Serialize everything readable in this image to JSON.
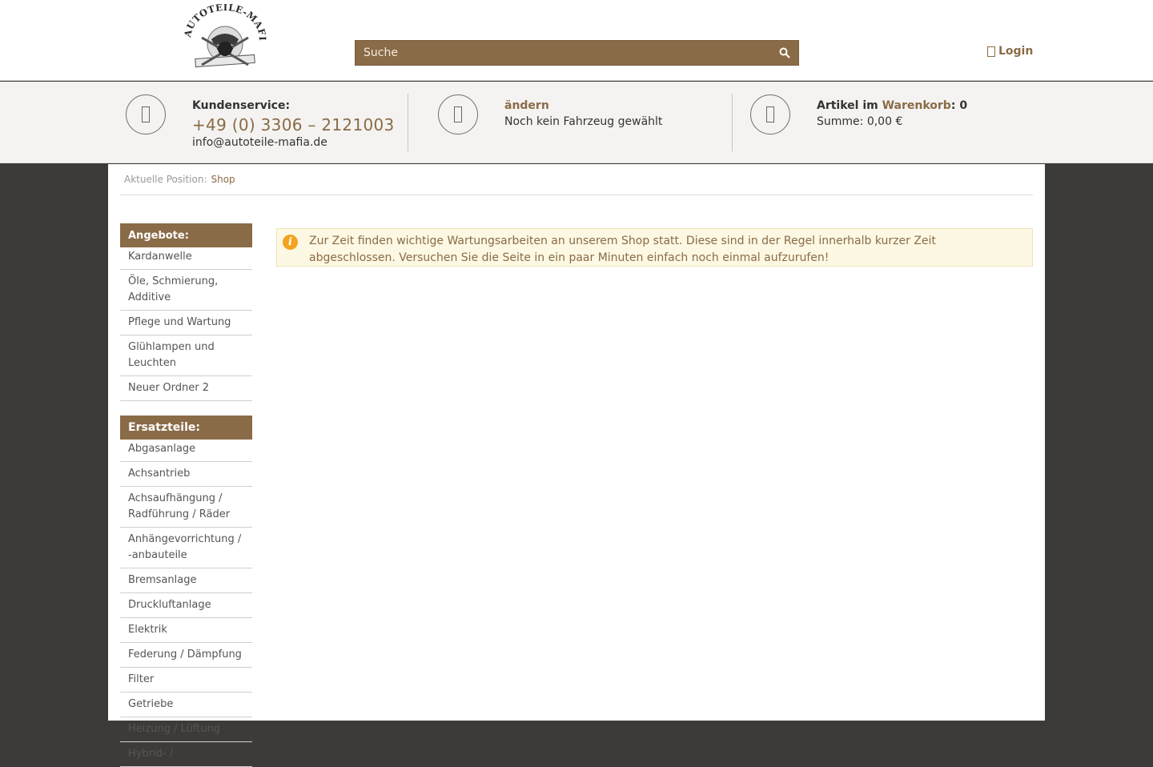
{
  "header": {
    "logo_text": "AUTOTEILE-MAFIA",
    "search_placeholder": "Suche",
    "login_label": "Login"
  },
  "infobar": {
    "service": {
      "title": "Kundenservice:",
      "phone": "+49 (0) 3306 – 2121003",
      "email": "info@autoteile-mafia.de"
    },
    "vehicle": {
      "change_label": "ändern",
      "status": "Noch kein Fahrzeug gewählt"
    },
    "cart": {
      "prefix": "Artikel im ",
      "link_label": "Warenkorb",
      "count": ": 0",
      "sum": "Summe: 0,00 €"
    }
  },
  "breadcrumb": {
    "label": "Aktuelle Position:",
    "current": "Shop"
  },
  "sidebar": {
    "offers_title": "Angebote:",
    "offers": [
      "Kardanwelle",
      "Öle, Schmierung, Additive",
      "Pflege und Wartung",
      "Glühlampen und Leuchten",
      "Neuer Ordner 2"
    ],
    "parts_title": "Ersatzteile:",
    "parts": [
      "Abgasanlage",
      "Achsantrieb",
      "Achsaufhängung / Radführung / Räder",
      "Anhängevorrichtung / -anbauteile",
      "Bremsanlage",
      "Druckluftanlage",
      "Elektrik",
      "Federung / Dämpfung",
      "Filter",
      "Getriebe",
      "Heizung / Lüftung",
      "Hybrid- /"
    ]
  },
  "notice": {
    "text": "Zur Zeit finden wichtige Wartungsarbeiten an unserem Shop statt. Diese sind in der Regel innerhalb kurzer Zeit abgeschlossen. Versuchen Sie die Seite in ein paar Minuten einfach noch einmal aufzurufen!"
  },
  "colors": {
    "brand_brown": "#8a6b47",
    "page_dark": "#3d3b39",
    "notice_bg": "#fcf8e3",
    "info_orange": "#f4a31f"
  }
}
